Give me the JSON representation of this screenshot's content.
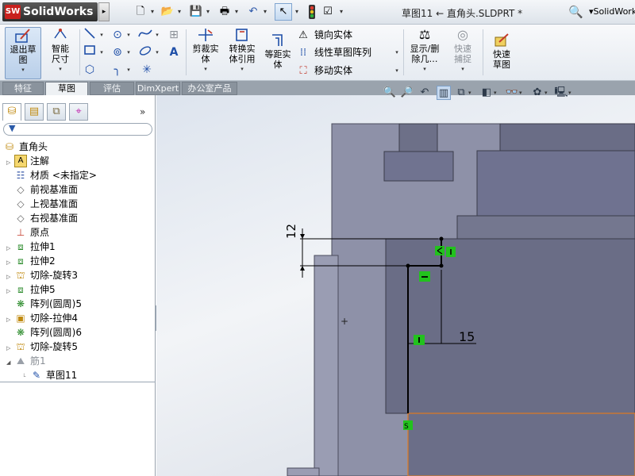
{
  "app": {
    "brand": "SolidWorks",
    "logo_badge": "SW",
    "doc_title": "草图11 ← 直角头.SLDPRT *",
    "search_label": "SolidWorks",
    "arrow_glyph": "▸"
  },
  "quick_access": [
    "new-document-icon",
    "open-icon",
    "save-icon",
    "print-icon",
    "undo-icon",
    "select-icon",
    "rebuild-icon",
    "options-icon"
  ],
  "ribbon": {
    "exit_sketch": "退出草图",
    "smart_dimension": "智能尺寸",
    "trim_entities": "剪裁实体",
    "convert_entities": "转换实体引用",
    "offset_entities": "等距实体",
    "mirror_entities": "镜向实体",
    "linear_pattern": "线性草图阵列",
    "move_entities": "移动实体",
    "display_delete_relations": "显示/删除几…",
    "quick_snaps": "快速捕捉",
    "rapid_sketch": "快速草图"
  },
  "tabs": [
    {
      "label": "特征",
      "active": false
    },
    {
      "label": "草图",
      "active": true
    },
    {
      "label": "评估",
      "active": false
    },
    {
      "label": "DimXpert",
      "active": false
    },
    {
      "label": "办公室产品",
      "active": false
    }
  ],
  "pane": {
    "expand_glyph": "»",
    "tabs": [
      "feature-manager",
      "property-manager",
      "configuration-manager",
      "dimxpert-manager"
    ]
  },
  "tree": {
    "root": "直角头",
    "items": [
      {
        "label": "注解",
        "icon": "annotation-icon",
        "expandable": true
      },
      {
        "label": "材质 <未指定>",
        "icon": "material-icon",
        "expandable": false
      },
      {
        "label": "前视基准面",
        "icon": "plane-icon",
        "expandable": false
      },
      {
        "label": "上视基准面",
        "icon": "plane-icon",
        "expandable": false
      },
      {
        "label": "右视基准面",
        "icon": "plane-icon",
        "expandable": false
      },
      {
        "label": "原点",
        "icon": "origin-icon",
        "expandable": false
      },
      {
        "label": "拉伸1",
        "icon": "extrude-icon",
        "expandable": true
      },
      {
        "label": "拉伸2",
        "icon": "extrude-icon",
        "expandable": true
      },
      {
        "label": "切除-旋转3",
        "icon": "revolve-cut-icon",
        "expandable": true
      },
      {
        "label": "拉伸5",
        "icon": "extrude-icon",
        "expandable": true
      },
      {
        "label": "阵列(圆周)5",
        "icon": "circular-pattern-icon",
        "expandable": false
      },
      {
        "label": "切除-拉伸4",
        "icon": "extrude-cut-icon",
        "expandable": true
      },
      {
        "label": "阵列(圆周)6",
        "icon": "circular-pattern-icon",
        "expandable": false
      },
      {
        "label": "切除-旋转5",
        "icon": "revolve-cut-icon",
        "expandable": true
      },
      {
        "label": "筋1",
        "icon": "rib-icon",
        "expandable": true,
        "grayed": true
      },
      {
        "label": "草图11",
        "icon": "sketch-icon",
        "expandable": false,
        "child": true
      }
    ]
  },
  "sketch": {
    "dim_vertical": "12",
    "dim_horizontal": "15",
    "cursor_glyph": "+"
  },
  "colors": {
    "model_dark": "#6a6d86",
    "model_light": "#8e91a8",
    "sketch_line": "#000000",
    "relation_badge": "#22c21d",
    "selected_edge": "#e07a20"
  }
}
